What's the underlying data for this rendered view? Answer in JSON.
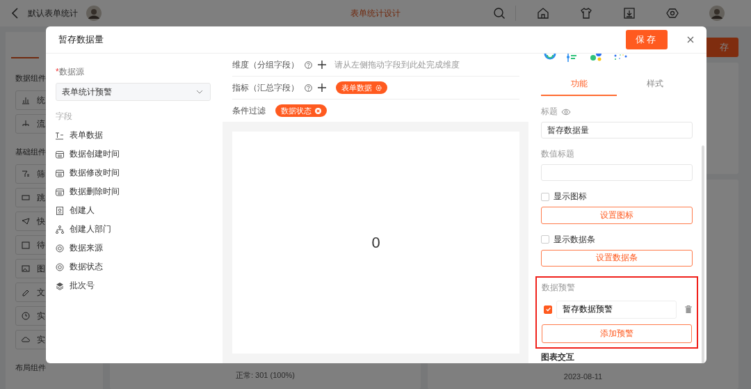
{
  "app": {
    "title": "默认表单统计",
    "page_title": "表单统计设计",
    "sidebar": [
      {
        "title": "数据组件",
        "items": [
          "统",
          "流"
        ]
      },
      {
        "title": "基础组件",
        "items": [
          "筛",
          "跳",
          "快",
          "待",
          "图",
          "文",
          "实",
          "实"
        ]
      },
      {
        "title": "布局组件"
      }
    ],
    "save_button": "存",
    "footers": [
      "正常: 301 (100%)",
      "2023-08-11"
    ]
  },
  "dialog": {
    "title": "暂存数据量",
    "save_button": "保存",
    "source": {
      "label": "数据源",
      "required_mark": "*",
      "value": "表单统计预警"
    },
    "fields_label": "字段",
    "fields": [
      {
        "name": "表单数据",
        "kind": "text"
      },
      {
        "name": "数据创建时间",
        "kind": "date"
      },
      {
        "name": "数据修改时间",
        "kind": "date"
      },
      {
        "name": "数据删除时间",
        "kind": "date"
      },
      {
        "name": "创建人",
        "kind": "user"
      },
      {
        "name": "创建人部门",
        "kind": "dept"
      },
      {
        "name": "数据来源",
        "kind": "select"
      },
      {
        "name": "数据状态",
        "kind": "select"
      },
      {
        "name": "批次号",
        "kind": "serial"
      }
    ],
    "rows": [
      {
        "label": "维度（分组字段）",
        "help": true,
        "hint": "请从左侧拖动字段到此处完成维度"
      },
      {
        "label": "指标（汇总字段）",
        "help": true,
        "tags": [
          {
            "text": "表单数据",
            "kind": "settings"
          }
        ]
      },
      {
        "label": "条件过滤",
        "help": false,
        "tags": [
          {
            "text": "数据状态",
            "kind": "remove"
          }
        ]
      }
    ],
    "preview_value": "0",
    "tabs": [
      {
        "label": "功能",
        "selected": true
      },
      {
        "label": "样式",
        "selected": false
      }
    ],
    "title_field": {
      "label": "标题",
      "value": "暂存数据量"
    },
    "value_title_field": {
      "label": "数值标题"
    },
    "options": [
      {
        "label": "显示图标",
        "checked": false,
        "button": "设置图标"
      },
      {
        "label": "显示数据条",
        "checked": false,
        "button": "设置数据条"
      }
    ],
    "alerts": {
      "label": "数据预警",
      "highlighted": true,
      "items": [
        {
          "checked": true,
          "value": "暂存数据预警"
        }
      ],
      "add_button": "添加预警"
    },
    "interaction_title": "图表交互"
  }
}
